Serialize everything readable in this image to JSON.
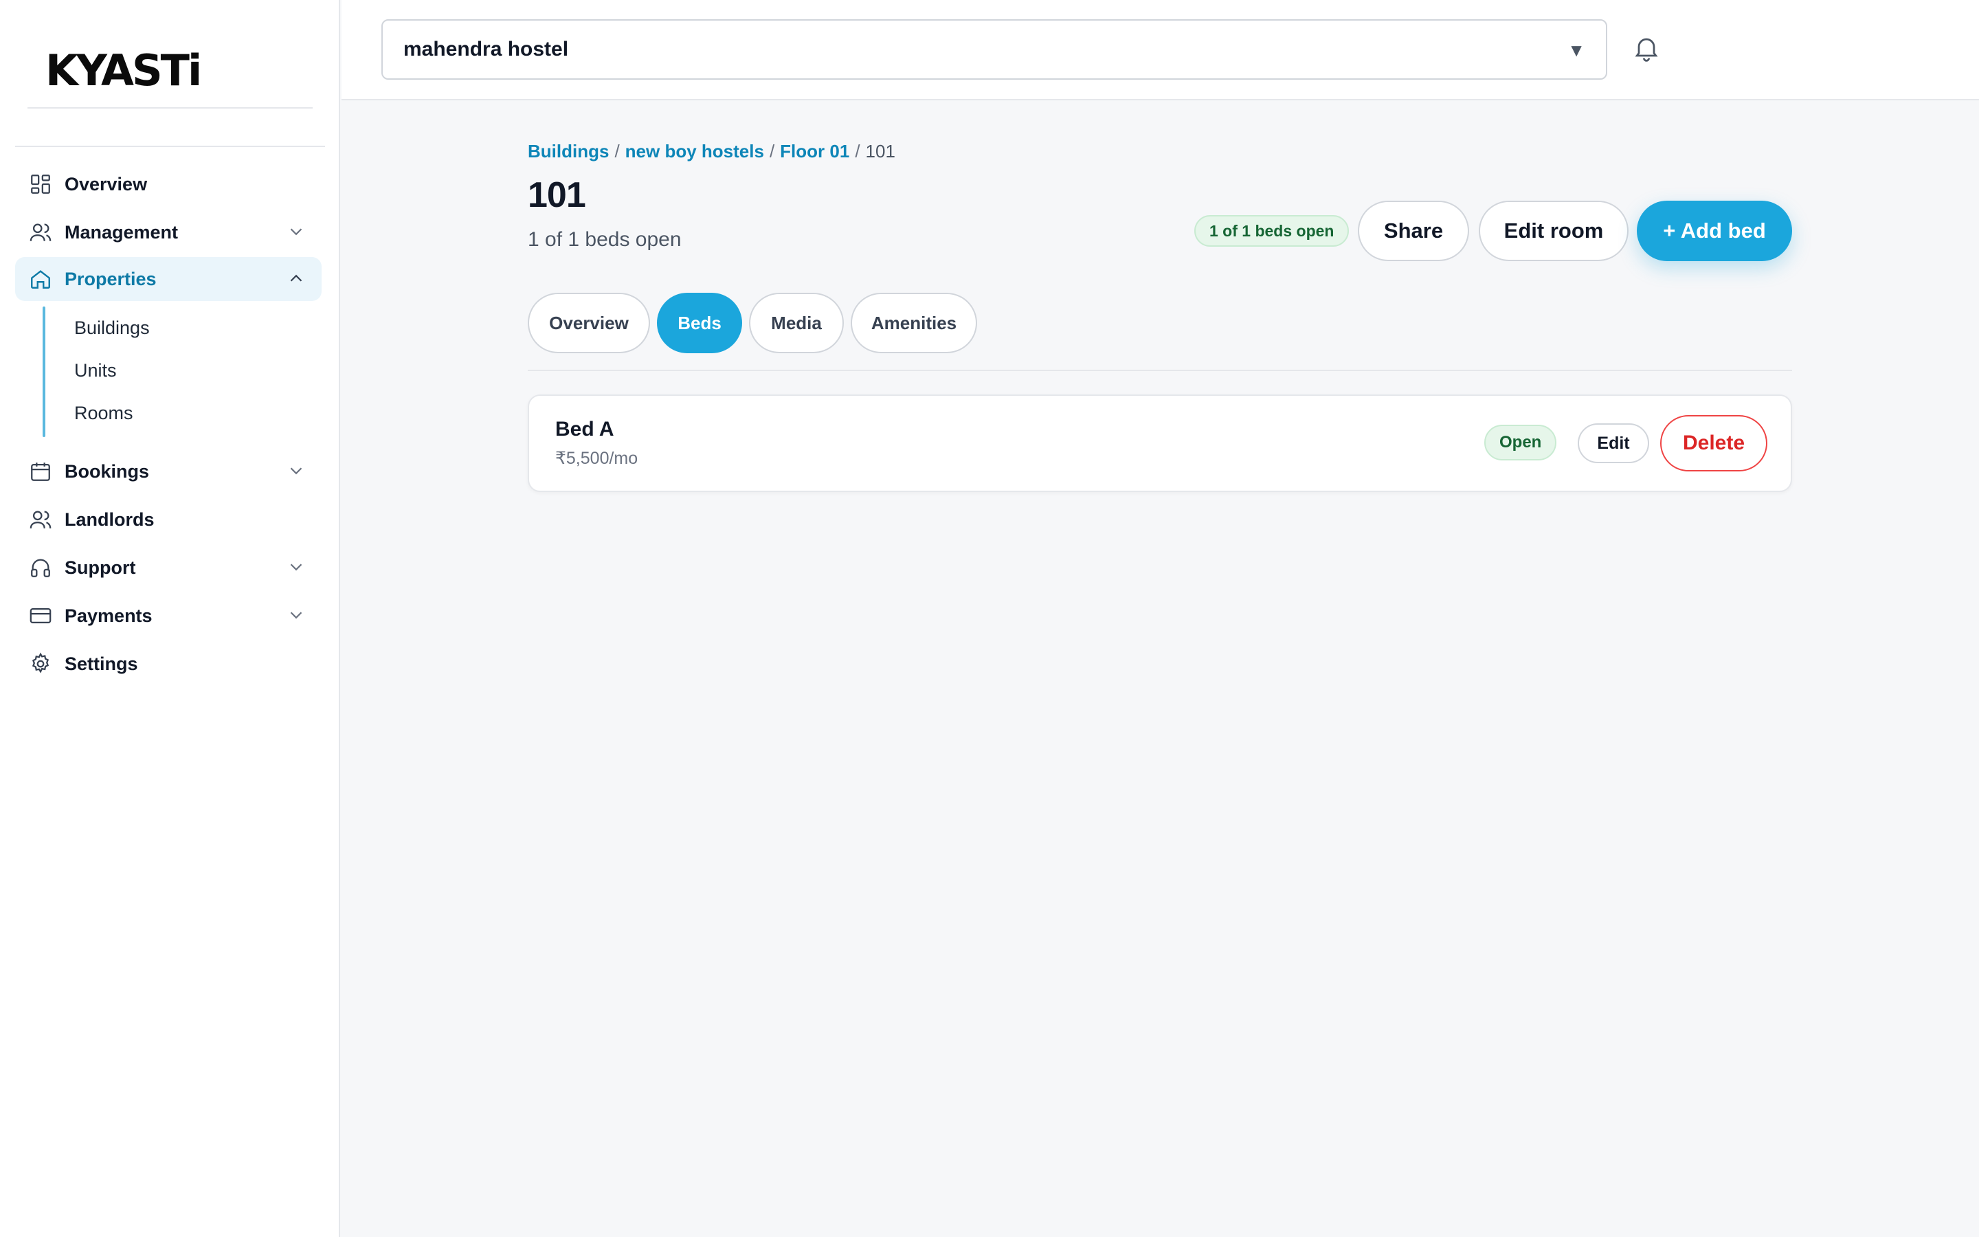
{
  "brand": {
    "logo_text": "KYASTi",
    "accent": "#14b8e6"
  },
  "sidebar": {
    "items": [
      {
        "label": "Overview",
        "icon": "grid-icon",
        "has_chevron": false
      },
      {
        "label": "Management",
        "icon": "users-icon",
        "has_chevron": true
      },
      {
        "label": "Properties",
        "icon": "home-icon",
        "has_chevron": true,
        "active": true
      },
      {
        "label": "Bookings",
        "icon": "calendar-icon",
        "has_chevron": true
      },
      {
        "label": "Landlords",
        "icon": "users-icon",
        "has_chevron": false
      },
      {
        "label": "Support",
        "icon": "headphones-icon",
        "has_chevron": true
      },
      {
        "label": "Payments",
        "icon": "credit-card-icon",
        "has_chevron": true
      },
      {
        "label": "Settings",
        "icon": "gear-icon",
        "has_chevron": false
      }
    ],
    "properties_sub": [
      "Buildings",
      "Units",
      "Rooms"
    ]
  },
  "topbar": {
    "selected_property": "mahendra hostel",
    "caret": "▼"
  },
  "breadcrumb": {
    "items": [
      "Buildings",
      "new boy hostels",
      "Floor 01"
    ],
    "current": "101",
    "separator": "/"
  },
  "room": {
    "title": "101",
    "subtitle": "1 of 1 beds open",
    "status_pill": "1 of 1 beds open"
  },
  "actions": {
    "share": "Share",
    "edit_room": "Edit room",
    "add_bed": "+ Add bed"
  },
  "tabs": [
    {
      "label": "Overview",
      "active": false
    },
    {
      "label": "Beds",
      "active": true
    },
    {
      "label": "Media",
      "active": false
    },
    {
      "label": "Amenities",
      "active": false
    }
  ],
  "beds": [
    {
      "name": "Bed A",
      "price": "₹5,500/mo",
      "status": "Open",
      "edit_label": "Edit",
      "delete_label": "Delete"
    }
  ],
  "colors": {
    "primary": "#1ba6dc",
    "link": "#0e86b8",
    "success_bg": "#e6f6ea",
    "success_text": "#166534",
    "danger": "#dc2626"
  }
}
